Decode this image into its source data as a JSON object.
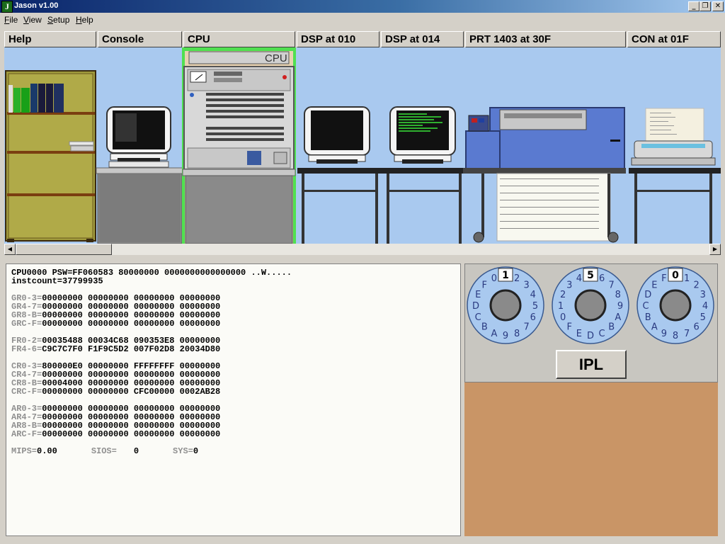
{
  "window": {
    "title": "Jason v1.00",
    "icon_letter": "J"
  },
  "menu": [
    {
      "label": "File",
      "hot": "F"
    },
    {
      "label": "View",
      "hot": "V"
    },
    {
      "label": "Setup",
      "hot": "S"
    },
    {
      "label": "Help",
      "hot": "H"
    }
  ],
  "tabs": [
    "Help",
    "Console",
    "CPU",
    "DSP at 010",
    "DSP at 014",
    "PRT 1403 at 30F",
    "CON at 01F"
  ],
  "active_tab": "CPU",
  "scene": {
    "cpu_label": "CPU"
  },
  "registers": {
    "psw_line": "CPU0000 PSW=FF060583 80000000 0000000000000000 ..W.....",
    "instcount_line": "instcount=37799935",
    "gr": [
      {
        "label": "GR0-3=",
        "values": "00000000 00000000 00000000 00000000"
      },
      {
        "label": "GR4-7=",
        "values": "00000000 00000000 00000000 00000000"
      },
      {
        "label": "GR8-B=",
        "values": "00000000 00000000 00000000 00000000"
      },
      {
        "label": "GRC-F=",
        "values": "00000000 00000000 00000000 00000000"
      }
    ],
    "fr": [
      {
        "label": "FR0-2=",
        "values": "00035488 00034C68 090353E8 00000000"
      },
      {
        "label": "FR4-6=",
        "values": "C9C7C7F0 F1F9C5D2 007F02D8 20034D80"
      }
    ],
    "cr": [
      {
        "label": "CR0-3=",
        "values": "800000E0 00000000 FFFFFFFF 00000000"
      },
      {
        "label": "CR4-7=",
        "values": "00000000 00000000 00000000 00000000"
      },
      {
        "label": "CR8-B=",
        "values": "00004000 00000000 00000000 00000000"
      },
      {
        "label": "CRC-F=",
        "values": "00000000 00000000 CFC00000 0002AB28"
      }
    ],
    "ar": [
      {
        "label": "AR0-3=",
        "values": "00000000 00000000 00000000 00000000"
      },
      {
        "label": "AR4-7=",
        "values": "00000000 00000000 00000000 00000000"
      },
      {
        "label": "AR8-B=",
        "values": "00000000 00000000 00000000 00000000"
      },
      {
        "label": "ARC-F=",
        "values": "00000000 00000000 00000000 00000000"
      }
    ],
    "stats": {
      "mips_label": "MIPS=",
      "mips_value": "0.00",
      "sios_label": "SIOS=",
      "sios_value": "0",
      "sys_label": "SYS=",
      "sys_value": "0"
    }
  },
  "dials": [
    {
      "value": "1"
    },
    {
      "value": "5"
    },
    {
      "value": "0"
    }
  ],
  "dial_digits": [
    "0",
    "1",
    "2",
    "3",
    "4",
    "5",
    "6",
    "7",
    "8",
    "9",
    "A",
    "B",
    "C",
    "D",
    "E",
    "F"
  ],
  "ipl_label": "IPL",
  "colors": {
    "active_tab": "#50e050",
    "scene_bg": "#a9c9ef",
    "panel_bg": "#c99566"
  }
}
